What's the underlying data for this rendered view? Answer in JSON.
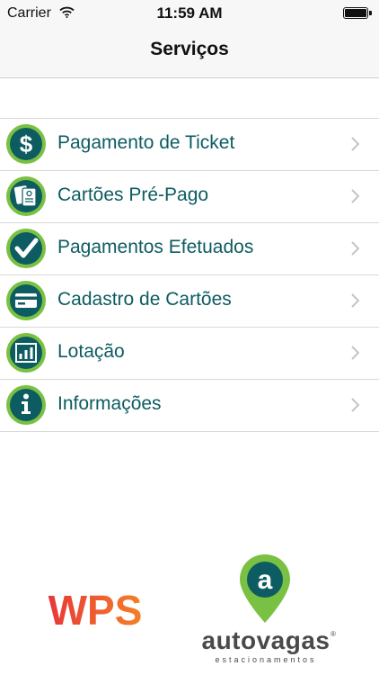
{
  "status_bar": {
    "carrier": "Carrier",
    "time": "11:59 AM"
  },
  "nav": {
    "title": "Serviços"
  },
  "menu": [
    {
      "label": "Pagamento de Ticket",
      "icon": "dollar-icon"
    },
    {
      "label": "Cartões Pré-Pago",
      "icon": "prepaid-card-icon"
    },
    {
      "label": "Pagamentos Efetuados",
      "icon": "checkmark-icon"
    },
    {
      "label": "Cadastro de Cartões",
      "icon": "credit-card-icon"
    },
    {
      "label": "Lotação",
      "icon": "chart-icon"
    },
    {
      "label": "Informações",
      "icon": "info-icon"
    }
  ],
  "brands": {
    "wps": "WPS",
    "autovagas": {
      "logo_letter": "a",
      "name": "autovagas",
      "registered": "®",
      "tagline": "estacionamentos"
    }
  },
  "colors": {
    "teal": "#0d5c61",
    "green": "#7ac143",
    "wps_red": "#e8373a",
    "wps_orange": "#f58025",
    "logo_gray": "#4a4a4a"
  }
}
